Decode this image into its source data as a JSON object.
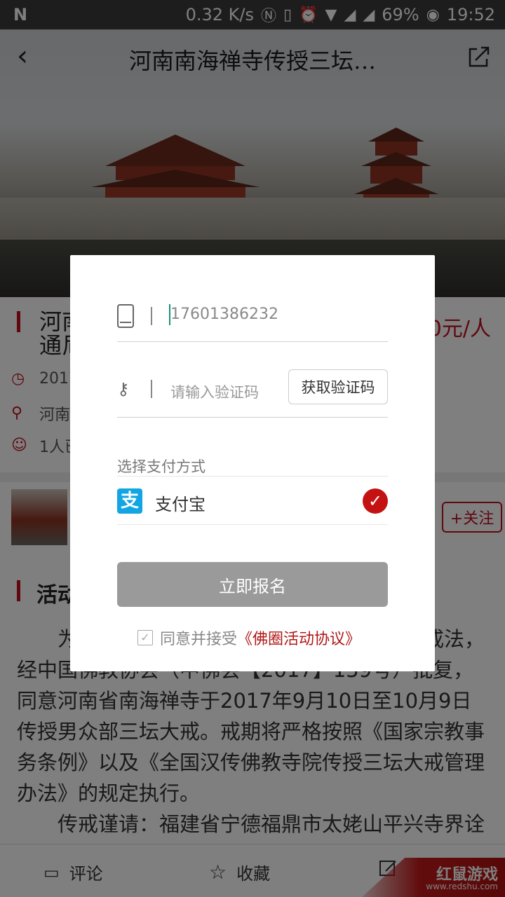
{
  "status_bar": {
    "speed": "0.32 K/s",
    "battery": "69%",
    "time": "19:52",
    "icons": [
      "nfc-icon",
      "vibrate-icon",
      "alarm-icon",
      "wifi-icon",
      "signal-icon",
      "signal-icon",
      "battery-icon"
    ]
  },
  "header": {
    "title": "河南南海禅寺传授三坛…",
    "back_icon": "back-arrow-icon",
    "share_icon": "share-icon"
  },
  "event": {
    "title_visible": "河南\n通尼",
    "price": "0元/人",
    "date_partial": "2017",
    "location_partial": "河南省",
    "attendees_partial": "1人已"
  },
  "organizer": {
    "follow_label": "+关注"
  },
  "section": {
    "heading_partial": "活动"
  },
  "body": {
    "paragraphs": [
      "为纪…………………………………大如来戒法，经中国佛教协会（中佛会【2017】159号）批复，同意河南省南海禅寺于2017年9月10日至10月9日传授男众部三坛大戒。戒期将严格按照《国家宗教事务条例》以及《全国汉传佛教寺院传授三坛大戒管理办法》的规定执行。",
      "传戒谨请：福建省宁德福鼎市太姥山平兴寺界诠法师为得戒和尚"
    ]
  },
  "bottom_bar": {
    "comment_label": "评论",
    "favorite_label": "收藏"
  },
  "watermark": {
    "main": "红鼠游戏",
    "sub": "www.redshu.com"
  },
  "modal": {
    "phone_value": "17601386232",
    "code_placeholder": "请输入验证码",
    "get_code_label": "获取验证码",
    "pay_title": "选择支付方式",
    "pay_method": "支付宝",
    "submit_label": "立即报名",
    "agree_text": "同意并接受",
    "agree_link": "《佛圈活动协议》"
  },
  "colors": {
    "accent": "#c01020",
    "alipay": "#12a5e3",
    "submit_disabled": "#9a9a9a"
  }
}
